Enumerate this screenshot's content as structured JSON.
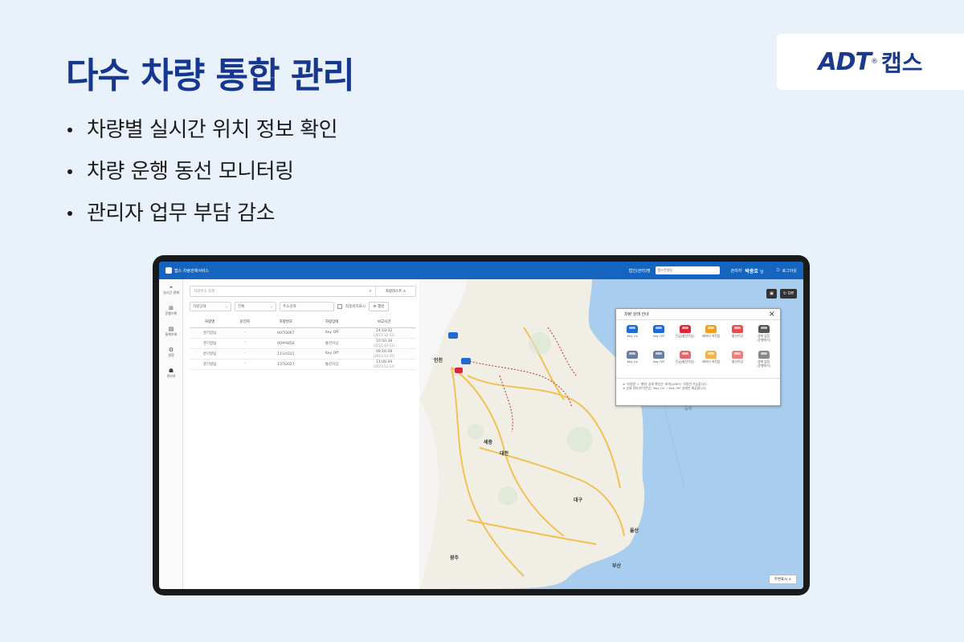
{
  "headline": "다수 차량 통합 관리",
  "bullets": [
    "차량별 실시간 위치 정보 확인",
    "차량 운행 동선 모니터링",
    "관리자 업무 부담 감소"
  ],
  "logo": {
    "brand": "ADT",
    "reg": "®",
    "ko": "캡스"
  },
  "app": {
    "brand": "캡스 차량관제서비스",
    "header_label": "법인(관리)명",
    "header_select": "캡스컨설팅",
    "user_prefix": "관리자",
    "user_name": "박종호",
    "user_suffix": "님",
    "logout": "로그아웃"
  },
  "nav": [
    {
      "icon": "location-icon",
      "glyph": "⌖",
      "label": "실시간 관제"
    },
    {
      "icon": "route-icon",
      "glyph": "⊞",
      "label": "운행기록"
    },
    {
      "icon": "stats-icon",
      "glyph": "▤",
      "label": "통계조회"
    },
    {
      "icon": "gear-icon",
      "glyph": "⚙",
      "label": "설정"
    },
    {
      "icon": "user-icon",
      "glyph": "☗",
      "label": "관리자"
    }
  ],
  "search": {
    "placeholder": "차량번호 조회",
    "mode": "차량리스트 ∧"
  },
  "filters": {
    "status": "차량상태",
    "group": "전체",
    "address": "주소검색",
    "checkbox_label": "최종위치표시",
    "refresh": "갱신"
  },
  "table": {
    "headers": [
      "차량명",
      "운전자",
      "차량번호",
      "차량상태",
      "보고시간"
    ],
    "rows": [
      {
        "name": "경기일팀",
        "driver": "-",
        "plate": "00하3067",
        "status": "Key Off",
        "time": "14:18:32",
        "date": "(2023-12-12)"
      },
      {
        "name": "경기일팀",
        "driver": "-",
        "plate": "00루9856",
        "status": "통신이상",
        "time": "10:50:39",
        "date": "(2023-12-11)"
      },
      {
        "name": "경기일팀",
        "driver": "-",
        "plate": "11오4221",
        "status": "Key Off",
        "time": "09:16:08",
        "date": "(2023-12-15)"
      },
      {
        "name": "경기일팀",
        "driver": "-",
        "plate": "12허3027",
        "status": "통신이상",
        "time": "11:06:09",
        "date": "(2023-12-12)"
      }
    ]
  },
  "map": {
    "toggle_icon": "▣",
    "toggle_off": "↻ Off",
    "bottom_button": "주변표시 ∧",
    "labels": [
      {
        "text": "인천"
      },
      {
        "text": "세종"
      },
      {
        "text": "대전"
      },
      {
        "text": "대구"
      },
      {
        "text": "울산"
      },
      {
        "text": "부산"
      },
      {
        "text": "광주"
      },
      {
        "text": "동해",
        "sea": true
      }
    ]
  },
  "legend": {
    "title": "차량 상태 안내",
    "items": [
      {
        "label": "Key On",
        "color": "#1e6bd6"
      },
      {
        "label": "Key Off",
        "color": "#1e6bd6"
      },
      {
        "label": "긴급(통신이상)",
        "color": "#d6283a"
      },
      {
        "label": "배터리 저전압",
        "color": "#f0a020"
      },
      {
        "label": "통신이상",
        "color": "#e05050"
      },
      {
        "label": "상태 없음\n(운행대기)",
        "color": "#555555"
      },
      {
        "label": "Key On",
        "color": "#6a7ea0"
      },
      {
        "label": "Key Off",
        "color": "#6a7ea0"
      },
      {
        "label": "긴급(통신이상)",
        "color": "#e06a70"
      },
      {
        "label": "배터리 저전압",
        "color": "#f3b24a"
      },
      {
        "label": "통신이상",
        "color": "#e88080"
      },
      {
        "label": "상태 없음\n(운행대기)",
        "color": "#888888"
      }
    ],
    "notes": [
      "※ '차량명' 1 '행위' 상태 확인은 '회색(GREY)' 차량만 가능합니다.",
      "※ 상태 정보(아이콘)는 'Key On' / 'Key Off' 상태만 제공합니다."
    ]
  },
  "colors": {
    "headline": "#16378f",
    "header_blue": "#1565c0",
    "background": "#e9f2fb"
  }
}
